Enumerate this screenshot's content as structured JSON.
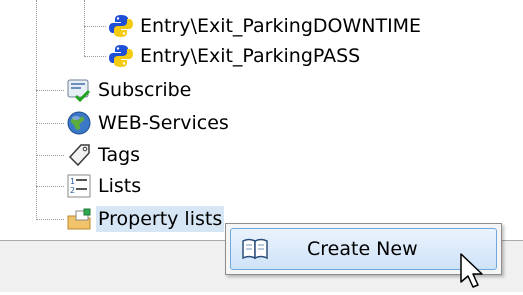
{
  "tree": {
    "items": [
      {
        "label": "Entry\\Exit_ParkingDOWNTIME",
        "icon": "python-icon"
      },
      {
        "label": "Entry\\Exit_ParkingPASS",
        "icon": "python-icon"
      },
      {
        "label": "Subscribe",
        "icon": "subscribe-icon"
      },
      {
        "label": "WEB-Services",
        "icon": "globe-icon"
      },
      {
        "label": "Tags",
        "icon": "tag-icon"
      },
      {
        "label": "Lists",
        "icon": "numbered-list-icon"
      },
      {
        "label": "Property lists",
        "icon": "property-list-icon"
      }
    ]
  },
  "context_menu": {
    "items": [
      {
        "label": "Create New",
        "icon": "book-icon"
      }
    ]
  },
  "colors": {
    "selection": "#d7e6f5",
    "menu_highlight": "#cfe3f8",
    "python_blue": "#1f4fd6",
    "python_yellow": "#f5cb12"
  }
}
